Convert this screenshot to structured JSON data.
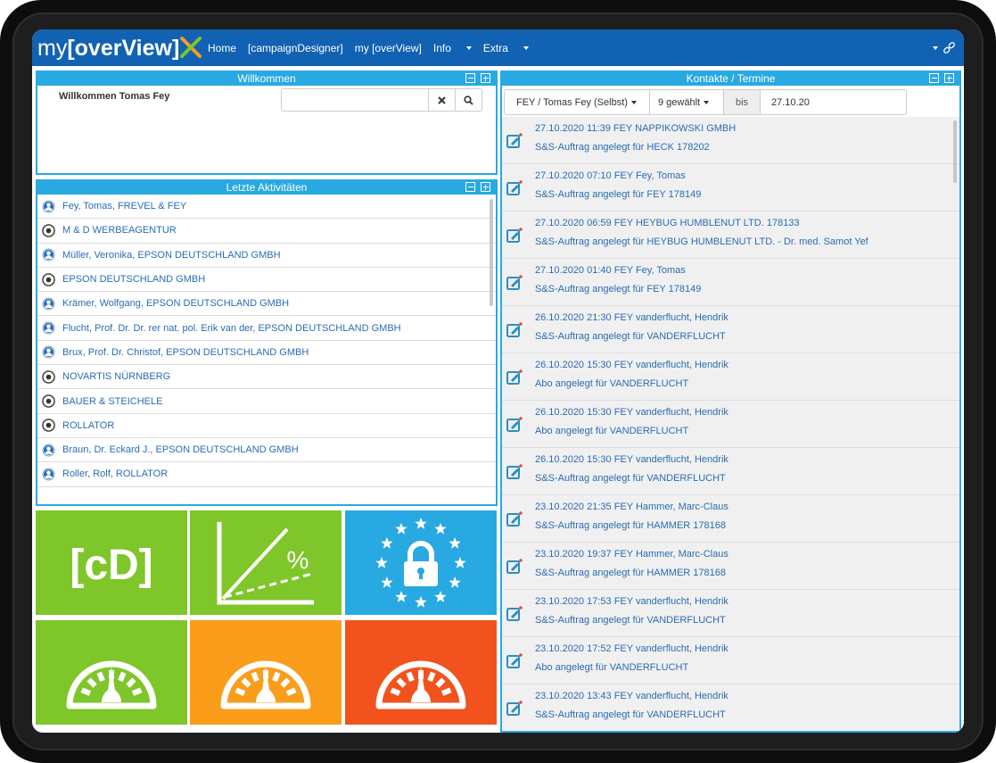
{
  "nav": {
    "logo_prefix": "my ",
    "logo_main": "[overView]",
    "items": [
      "Home",
      "[campaignDesigner]",
      "my [overView]",
      "Info",
      "Extra"
    ],
    "right_icon": "link-icon"
  },
  "welcome": {
    "title": "Willkommen",
    "greeting": "Willkommen Tomas Fey",
    "search_value": ""
  },
  "activities": {
    "title": "Letzte Aktivitäten",
    "items": [
      {
        "text": "Fey, Tomas, FREVEL & FEY",
        "icon": "person-icon"
      },
      {
        "text": "M & D WERBEAGENTUR",
        "icon": "company-icon"
      },
      {
        "text": "Müller, Veronika, EPSON DEUTSCHLAND GMBH",
        "icon": "person-icon"
      },
      {
        "text": "EPSON DEUTSCHLAND GMBH",
        "icon": "company-icon"
      },
      {
        "text": "Krämer, Wolfgang, EPSON DEUTSCHLAND GMBH",
        "icon": "person-icon"
      },
      {
        "text": "Flucht, Prof. Dr. Dr. rer nat. pol. Erik van der, EPSON DEUTSCHLAND GMBH",
        "icon": "person-icon"
      },
      {
        "text": "Brux, Prof. Dr. Christof, EPSON DEUTSCHLAND GMBH",
        "icon": "person-icon"
      },
      {
        "text": "NOVARTIS NÜRNBERG",
        "icon": "company-icon"
      },
      {
        "text": "BAUER & STEICHELE",
        "icon": "company-icon"
      },
      {
        "text": "ROLLATOR",
        "icon": "company-icon"
      },
      {
        "text": "Braun, Dr. Eckard J., EPSON DEUTSCHLAND GMBH",
        "icon": "person-icon"
      },
      {
        "text": "Roller, Rolf, ROLLATOR",
        "icon": "person-icon"
      }
    ]
  },
  "tiles": [
    {
      "name": "campaign-designer-tile",
      "icon": "cd-logo-icon",
      "label": "[cD]",
      "color": "#7ec629"
    },
    {
      "name": "percentage-chart-tile",
      "icon": "percentage-chart-icon",
      "label": "%",
      "color": "#7ec629"
    },
    {
      "name": "data-protection-tile",
      "icon": "eu-lock-icon",
      "color": "#29a9e1"
    },
    {
      "name": "gauge-green-tile",
      "icon": "gauge-icon",
      "color": "#7ec629"
    },
    {
      "name": "gauge-orange-tile",
      "icon": "gauge-icon",
      "color": "#f99d1b"
    },
    {
      "name": "gauge-red-tile",
      "icon": "gauge-icon",
      "color": "#f1521e"
    }
  ],
  "contacts": {
    "title": "Kontakte / Termine",
    "filter_user": "FEY / Tomas Fey (Selbst)",
    "filter_count": "9 gewählt",
    "bis_label": "bis",
    "date_value": "27.10.20",
    "items": [
      {
        "l1": "27.10.2020 11:39 FEY NAPPIKOWSKI GMBH",
        "l2": "S&S-Auftrag angelegt für HECK 178202"
      },
      {
        "l1": "27.10.2020 07:10 FEY Fey, Tomas",
        "l2": "S&S-Auftrag angelegt für FEY 178149"
      },
      {
        "l1": "27.10.2020 06:59 FEY HEYBUG HUMBLENUT LTD. 178133",
        "l2": "S&S-Auftrag angelegt für HEYBUG HUMBLENUT LTD. - Dr. med. Samot Yef"
      },
      {
        "l1": "27.10.2020 01:40 FEY Fey, Tomas",
        "l2": "S&S-Auftrag angelegt für FEY 178149"
      },
      {
        "l1": "26.10.2020 21:30 FEY vanderflucht, Hendrik",
        "l2": "S&S-Auftrag angelegt für VANDERFLUCHT"
      },
      {
        "l1": "26.10.2020 15:30 FEY vanderflucht, Hendrik",
        "l2": "Abo angelegt für VANDERFLUCHT"
      },
      {
        "l1": "26.10.2020 15:30 FEY vanderflucht, Hendrik",
        "l2": "Abo angelegt für VANDERFLUCHT"
      },
      {
        "l1": "26.10.2020 15:30 FEY vanderflucht, Hendrik",
        "l2": "S&S-Auftrag angelegt für VANDERFLUCHT"
      },
      {
        "l1": "23.10.2020 21:35 FEY Hammer, Marc-Claus",
        "l2": "S&S-Auftrag angelegt für HAMMER 178168"
      },
      {
        "l1": "23.10.2020 19:37 FEY Hammer, Marc-Claus",
        "l2": "S&S-Auftrag angelegt für HAMMER 178168"
      },
      {
        "l1": "23.10.2020 17:53 FEY vanderflucht, Hendrik",
        "l2": "S&S-Auftrag angelegt für VANDERFLUCHT"
      },
      {
        "l1": "23.10.2020 17:52 FEY vanderflucht, Hendrik",
        "l2": "Abo angelegt für VANDERFLUCHT"
      },
      {
        "l1": "23.10.2020 13:43 FEY vanderflucht, Hendrik",
        "l2": "S&S-Auftrag angelegt für VANDERFLUCHT"
      }
    ]
  },
  "colors": {
    "nav_bg": "#1262b3",
    "panel_accent": "#29a9e1",
    "link_text": "#2a6cb3",
    "logo_x_orange": "#f99d1b",
    "logo_x_green": "#7ec629"
  }
}
